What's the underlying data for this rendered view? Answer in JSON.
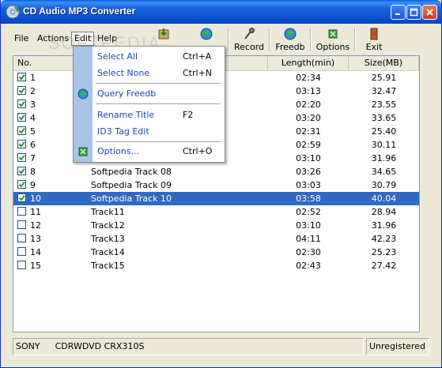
{
  "window": {
    "title": "CD Audio MP3 Converter"
  },
  "menu": {
    "file": "File",
    "actions": "Actions",
    "edit": "Edit",
    "help": "Help"
  },
  "toolbar": {
    "record": "Record",
    "freedb": "Freedb",
    "options": "Options",
    "exit": "Exit"
  },
  "edit_menu": {
    "select_all": "Select All",
    "select_all_shortcut": "Ctrl+A",
    "select_none": "Select None",
    "select_none_shortcut": "Ctrl+N",
    "query_freedb": "Query Freedb",
    "rename_title": "Rename Title",
    "rename_title_shortcut": "F2",
    "id3_tag_edit": "ID3 Tag Edit",
    "options": "Options...",
    "options_shortcut": "Ctrl+O"
  },
  "columns": {
    "no": "No.",
    "length": "Length(min)",
    "size": "Size(MB)"
  },
  "tracks": [
    {
      "no": "1",
      "title": "",
      "length": "02:34",
      "size": "25.91",
      "checked": true
    },
    {
      "no": "2",
      "title": "",
      "length": "03:13",
      "size": "32.47",
      "checked": true
    },
    {
      "no": "3",
      "title": "",
      "length": "02:20",
      "size": "23.55",
      "checked": true
    },
    {
      "no": "4",
      "title": "",
      "length": "03:20",
      "size": "33.65",
      "checked": true
    },
    {
      "no": "5",
      "title": "",
      "length": "02:31",
      "size": "25.40",
      "checked": true
    },
    {
      "no": "6",
      "title": "",
      "length": "02:59",
      "size": "30.11",
      "checked": true
    },
    {
      "no": "7",
      "title": "",
      "length": "03:10",
      "size": "31.96",
      "checked": true
    },
    {
      "no": "8",
      "title": "Softpedia Track 08",
      "length": "03:26",
      "size": "34.65",
      "checked": true
    },
    {
      "no": "9",
      "title": "Softpedia Track 09",
      "length": "03:03",
      "size": "30.79",
      "checked": true
    },
    {
      "no": "10",
      "title": "Softpedia Track 10",
      "length": "03:58",
      "size": "40.04",
      "checked": true,
      "selected": true
    },
    {
      "no": "11",
      "title": "Track11",
      "length": "02:52",
      "size": "28.94",
      "checked": false
    },
    {
      "no": "12",
      "title": "Track12",
      "length": "03:10",
      "size": "31.96",
      "checked": false
    },
    {
      "no": "13",
      "title": "Track13",
      "length": "04:11",
      "size": "42.23",
      "checked": false
    },
    {
      "no": "14",
      "title": "Track14",
      "length": "02:30",
      "size": "25.23",
      "checked": false
    },
    {
      "no": "15",
      "title": "Track15",
      "length": "02:43",
      "size": "27.42",
      "checked": false
    }
  ],
  "status": {
    "drive_vendor": "SONY",
    "drive_model": "CDRWDVD CRX310S",
    "registration": "Unregistered"
  },
  "watermark": "SOFTPEDIA",
  "colors": {
    "titlebar": "#0a4fd2",
    "selection": "#316ac5",
    "menu_strip": "#a8c4e8"
  }
}
